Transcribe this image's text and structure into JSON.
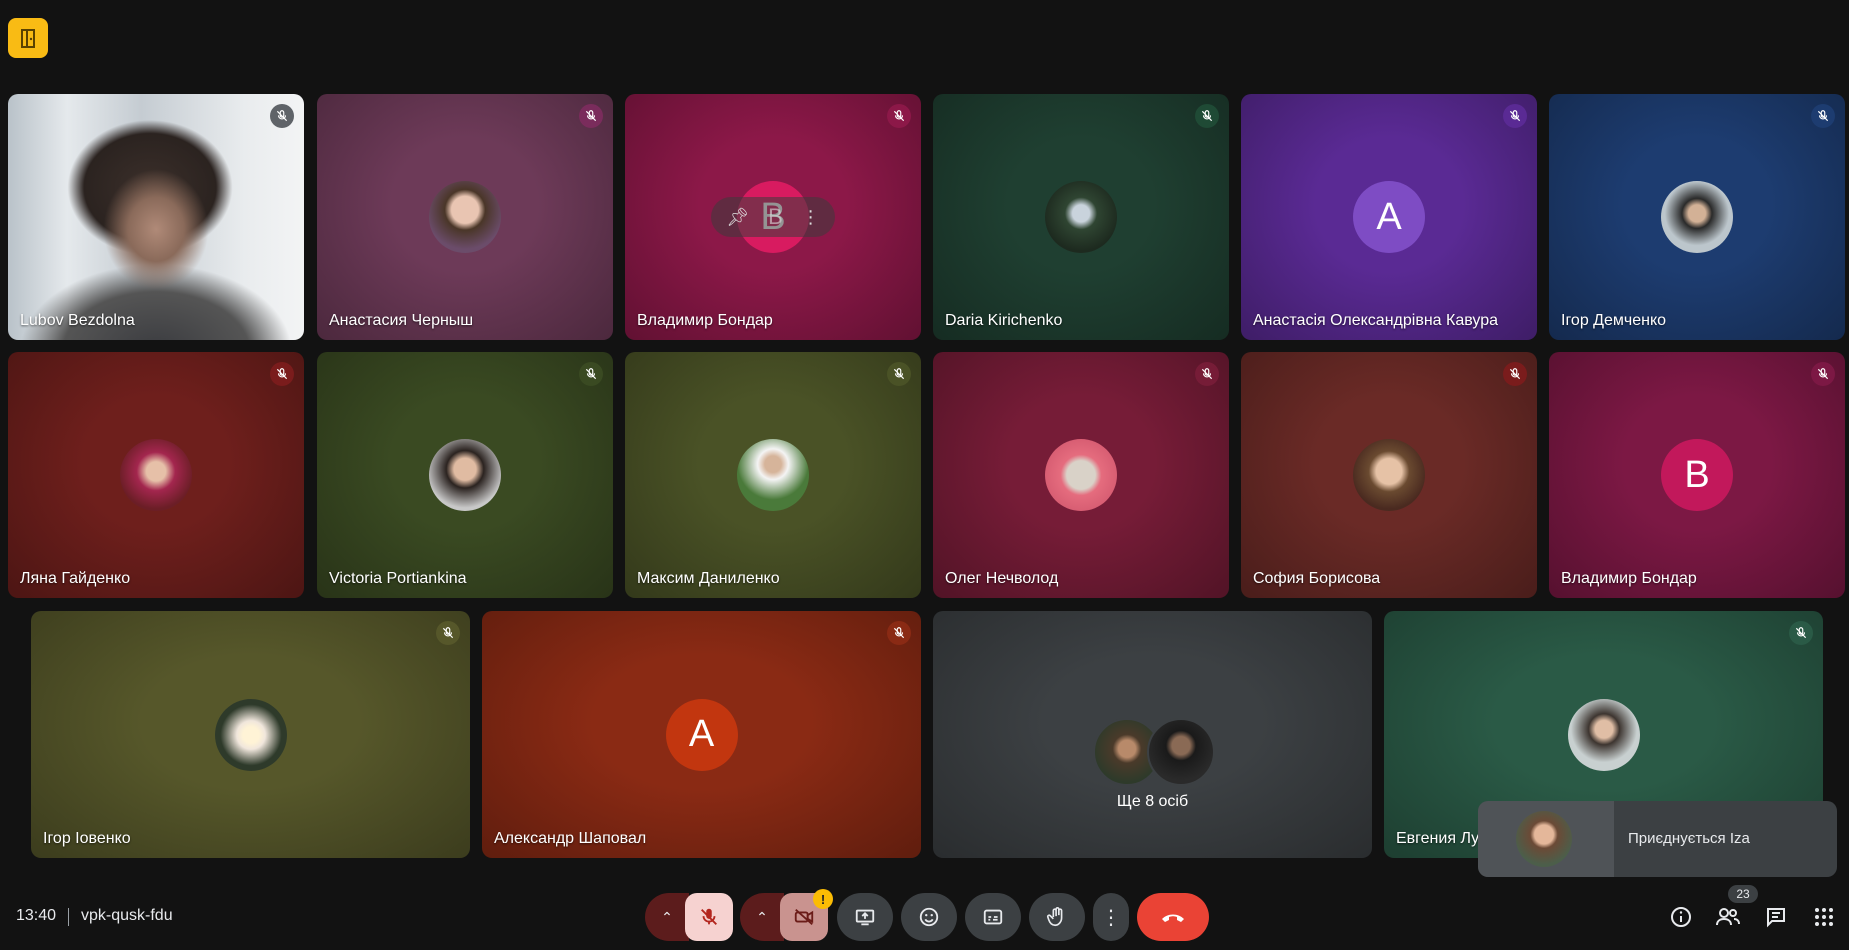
{
  "app": {
    "brand_icon": "meet-door-icon",
    "brand_color": "#f9bb14"
  },
  "tiles": [
    {
      "name": "Lubov Bezdolna",
      "bg": "#9aa1a6",
      "photo": true,
      "mic_color": "#5f6368"
    },
    {
      "name": "Анастасия Черныш",
      "bg": "#6d3a58",
      "avatar_bg": "radial-gradient(circle at 50% 40%, #e9c5b2 0 24%, #4a3628 36%, #6b4c6a 70%)",
      "mic_color": "#7a2c5c"
    },
    {
      "name": "Владимир Бондар",
      "bg": "#8c1848",
      "avatar_letter": "B",
      "avatar_bg": "#d81b60",
      "mic_color": "#8c1848",
      "hover": true
    },
    {
      "name": "Daria Kirichenko",
      "bg": "#1f3f31",
      "avatar_bg": "radial-gradient(circle at 50% 45%, #c9d3dc 0 16%, #2f4532 30%, #1d2a1f 70%)",
      "mic_color": "#1f4a35"
    },
    {
      "name": "Анастасія Олександрівна Кавура",
      "bg": "#5a2a94",
      "avatar_letter": "A",
      "avatar_bg": "#7e4cc4",
      "mic_color": "#5a2a94"
    },
    {
      "name": "Ігор Демченко",
      "bg": "#1d3c70",
      "avatar_bg": "radial-gradient(circle at 50% 45%, #d3b196 0 16%, #2a2a2a 28%, #bcc6cc 60%)",
      "mic_color": "#1d3c70"
    },
    {
      "name": "Ляна Гайденко",
      "bg": "#6e1f1c",
      "avatar_bg": "radial-gradient(circle at 50% 45%, #e6c0a8 0 18%, #a3264e 36%, #6b1e26 70%)",
      "mic_color": "#7a1c1c"
    },
    {
      "name": "Victoria Portiankina",
      "bg": "#3a4a22",
      "avatar_bg": "radial-gradient(circle at 50% 42%, #e0bba2 0 20%, #2b2320 34%, #c8c8c8 70%)",
      "mic_color": "#3a4a22"
    },
    {
      "name": "Максим Даниленко",
      "bg": "#4a5226",
      "avatar_bg": "radial-gradient(circle at 50% 35%, #d6b49a 0 14%, #f4f4f4 26%, #4a7a3a 60%)",
      "mic_color": "#4a5226"
    },
    {
      "name": "Олег Нечволод",
      "bg": "#761c37",
      "avatar_bg": "radial-gradient(circle at 50% 50%, #d9d2c8 0 28%, #e56c7e 40%, #d85e73 70%)",
      "mic_color": "#761c37"
    },
    {
      "name": "София Борисова",
      "bg": "#6a2a26",
      "avatar_bg": "radial-gradient(circle at 50% 45%, #e6c2a6 0 24%, #6a4a30 38%, #4a2a20 70%)",
      "mic_color": "#7a1c1c"
    },
    {
      "name": "Владимир Бондар",
      "bg": "#7c1844",
      "avatar_letter": "B",
      "avatar_bg": "#c2185b",
      "mic_color": "#7c1844"
    },
    {
      "name": "Ігор Іовенко",
      "bg": "#56572a",
      "avatar_bg": "radial-gradient(circle at 50% 50%, #fff3d6 0 16%, #f0e6dc 28%, #2e3a2a 60%)",
      "mic_color": "#56572a"
    },
    {
      "name": "Александр Шаповал",
      "bg": "#8a2a14",
      "avatar_letter": "A",
      "avatar_bg": "#c2360f",
      "mic_color": "#8a2a14"
    },
    {
      "name": "",
      "bg": "#3c4043",
      "more": true
    },
    {
      "name": "Евгения Лу",
      "bg": "#2a5a46",
      "avatar_bg": "radial-gradient(circle at 50% 42%, #e0bea5 0 16%, #3d3530 28%, #c8d0d0 60%)",
      "mic_color": "#2a5a46"
    }
  ],
  "more_tile": {
    "label": "Ще 8 осіб"
  },
  "hover_controls": {
    "pin_icon": "pin-icon",
    "more_icon": "more-vert-icon"
  },
  "toast": {
    "text": "Приєднується Іzа"
  },
  "bottom": {
    "time": "13:40",
    "meeting_code": "vpk-qusk-fdu",
    "participants_count": "23",
    "warning": "!"
  }
}
